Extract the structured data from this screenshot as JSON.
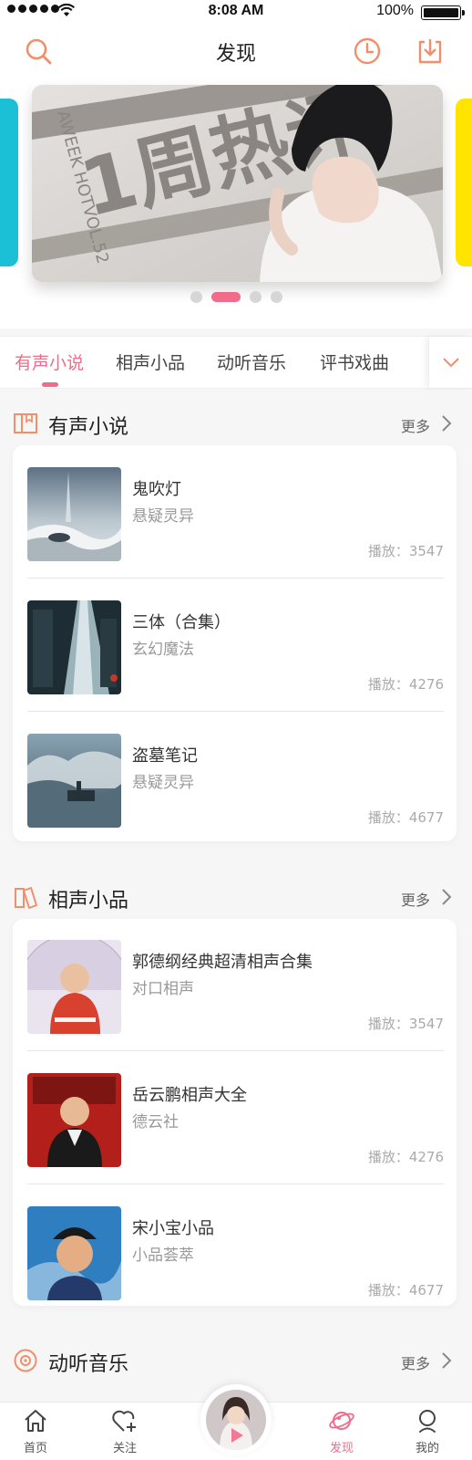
{
  "status_bar": {
    "time": "8:08 AM",
    "battery": "100%"
  },
  "header": {
    "title": "发现"
  },
  "banner": {
    "text_big": "1周热评",
    "text_side": "AWEEK HOTVOL.52"
  },
  "tabs": [
    {
      "label": "有声小说"
    },
    {
      "label": "相声小品"
    },
    {
      "label": "动听音乐"
    },
    {
      "label": "评书戏曲"
    }
  ],
  "sections": [
    {
      "title": "有声小说",
      "more": "更多",
      "items": [
        {
          "title": "鬼吹灯",
          "category": "悬疑灵异",
          "plays": "播放：3547"
        },
        {
          "title": "三体（合集）",
          "category": "玄幻魔法",
          "plays": "播放：4276"
        },
        {
          "title": "盗墓笔记",
          "category": "悬疑灵异",
          "plays": "播放：4677"
        }
      ]
    },
    {
      "title": "相声小品",
      "more": "更多",
      "items": [
        {
          "title": "郭德纲经典超清相声合集",
          "category": "对口相声",
          "plays": "播放：3547"
        },
        {
          "title": "岳云鹏相声大全",
          "category": "德云社",
          "plays": "播放：4276"
        },
        {
          "title": "宋小宝小品",
          "category": "小品荟萃",
          "plays": "播放：4677"
        }
      ]
    },
    {
      "title": "动听音乐",
      "more": "更多"
    }
  ],
  "bottom_nav": [
    {
      "label": "首页",
      "icon": "home-icon"
    },
    {
      "label": "关注",
      "icon": "heart-plus-icon"
    },
    {
      "label": "发现",
      "icon": "planet-icon"
    },
    {
      "label": "我的",
      "icon": "user-icon"
    }
  ],
  "colors": {
    "accent": "#f26b8a",
    "icon_orange": "#f08f6a",
    "background": "#f6f6f7"
  }
}
